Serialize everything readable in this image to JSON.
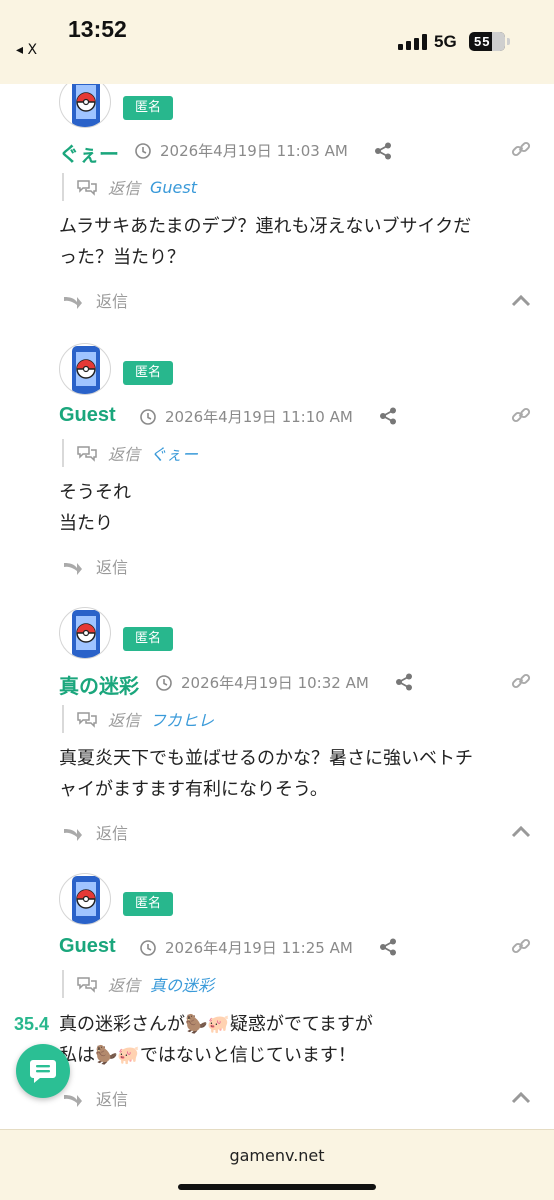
{
  "status_bar": {
    "time": "13:52",
    "back_label": "◂ X",
    "network": "5G",
    "battery": "55"
  },
  "badge_label": "匿名",
  "reply_word": "返信",
  "comments": [
    {
      "author": "ぐぇー",
      "timestamp": "2026年4月19日 11:03 AM",
      "reply_to": "Guest",
      "body": [
        "ムラサキあたまのデブ？連れも冴えないブサイクだ",
        "った？当たり？"
      ]
    },
    {
      "author": "Guest",
      "timestamp": "2026年4月19日 11:10 AM",
      "reply_to": "ぐぇー",
      "body": [
        "そうそれ",
        "当たり"
      ]
    },
    {
      "author": "真の迷彩",
      "timestamp": "2026年4月19日 10:32 AM",
      "reply_to": "フカヒレ",
      "body": [
        "真夏炎天下でも並ばせるのかな？暑さに強いベトチ",
        "ャイがますます有利になりそう。"
      ]
    },
    {
      "author": "Guest",
      "timestamp": "2026年4月19日 11:25 AM",
      "reply_to": "真の迷彩",
      "body": [
        "真の迷彩さんが🦫🐖疑惑がでてますが",
        "私は🦫🐖ではないと信じています！"
      ]
    }
  ],
  "floating": {
    "value": "35.4"
  },
  "footer": {
    "domain": "gamenv.net"
  },
  "colors": {
    "accent": "#28b78d",
    "link": "#3a9ad9",
    "bar_bg": "#faf4e2"
  },
  "icons": [
    "pokeball-avatar-icon",
    "clock-icon",
    "share-icon",
    "link-icon",
    "reply-arrow-icon",
    "chevron-up-icon",
    "comment-icon",
    "chat-bubble-icon"
  ]
}
